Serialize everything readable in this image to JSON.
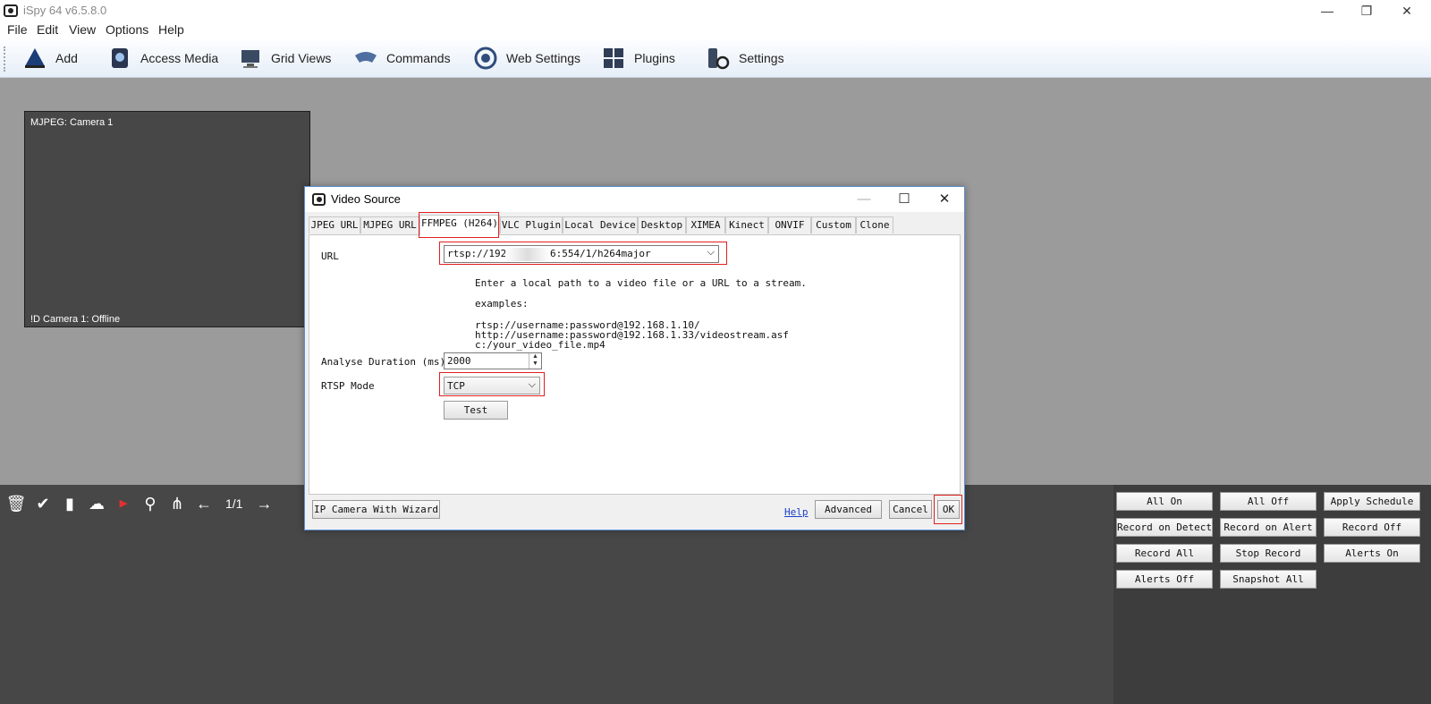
{
  "app": {
    "title": "iSpy 64 v6.5.8.0"
  },
  "window_controls": {
    "minimize": "—",
    "restore": "❐",
    "close": "✕"
  },
  "menu": [
    "File",
    "Edit",
    "View",
    "Options",
    "Help"
  ],
  "toolbar": [
    {
      "label": "Add",
      "icon": "add-icon"
    },
    {
      "label": "Access Media",
      "icon": "access-media-icon"
    },
    {
      "label": "Grid Views",
      "icon": "grid-views-icon"
    },
    {
      "label": "Commands",
      "icon": "commands-icon"
    },
    {
      "label": "Web Settings",
      "icon": "web-settings-icon"
    },
    {
      "label": "Plugins",
      "icon": "plugins-icon"
    },
    {
      "label": "Settings",
      "icon": "settings-icon"
    }
  ],
  "camera": {
    "title": "MJPEG: Camera 1",
    "status": "!D  Camera 1: Offline"
  },
  "pager": {
    "indicator": "1/1"
  },
  "command_buttons": [
    [
      "All On",
      "All Off",
      "Apply Schedule"
    ],
    [
      "Record on Detect",
      "Record on Alert",
      "Record Off"
    ],
    [
      "Record All",
      "Stop Record",
      "Alerts On"
    ],
    [
      "Alerts Off",
      "Snapshot All"
    ]
  ],
  "dialog": {
    "title": "Video Source",
    "controls": {
      "minimize": "—",
      "maximize": "☐",
      "close": "✕"
    },
    "tabs": [
      "JPEG URL",
      "MJPEG URL",
      "FFMPEG (H264)",
      "VLC Plugin",
      "Local Device",
      "Desktop",
      "XIMEA",
      "Kinect",
      "ONVIF",
      "Custom",
      "Clone"
    ],
    "active_tab": "FFMPEG (H264)",
    "url_label": "URL",
    "url_value_prefix": "rtsp://192.",
    "url_value_suffix": "6:554/1/h264major",
    "help_lines": [
      "Enter a local path to a video file or a URL to a stream.",
      "examples:",
      "rtsp://username:password@192.168.1.10/\nhttp://username:password@192.168.1.33/videostream.asf\nc:/your_video_file.mp4"
    ],
    "analyse_label": "Analyse Duration (ms)",
    "analyse_value": "2000",
    "rtsp_label": "RTSP Mode",
    "rtsp_value": "TCP",
    "test_button": "Test",
    "wizard_button": "IP Camera With Wizard",
    "help_link": "Help",
    "advanced_button": "Advanced",
    "cancel_button": "Cancel",
    "ok_button": "OK"
  },
  "colors": {
    "highlight": "#e02020",
    "link": "#1a3fc9",
    "dialog_border": "#5d8ed3"
  }
}
